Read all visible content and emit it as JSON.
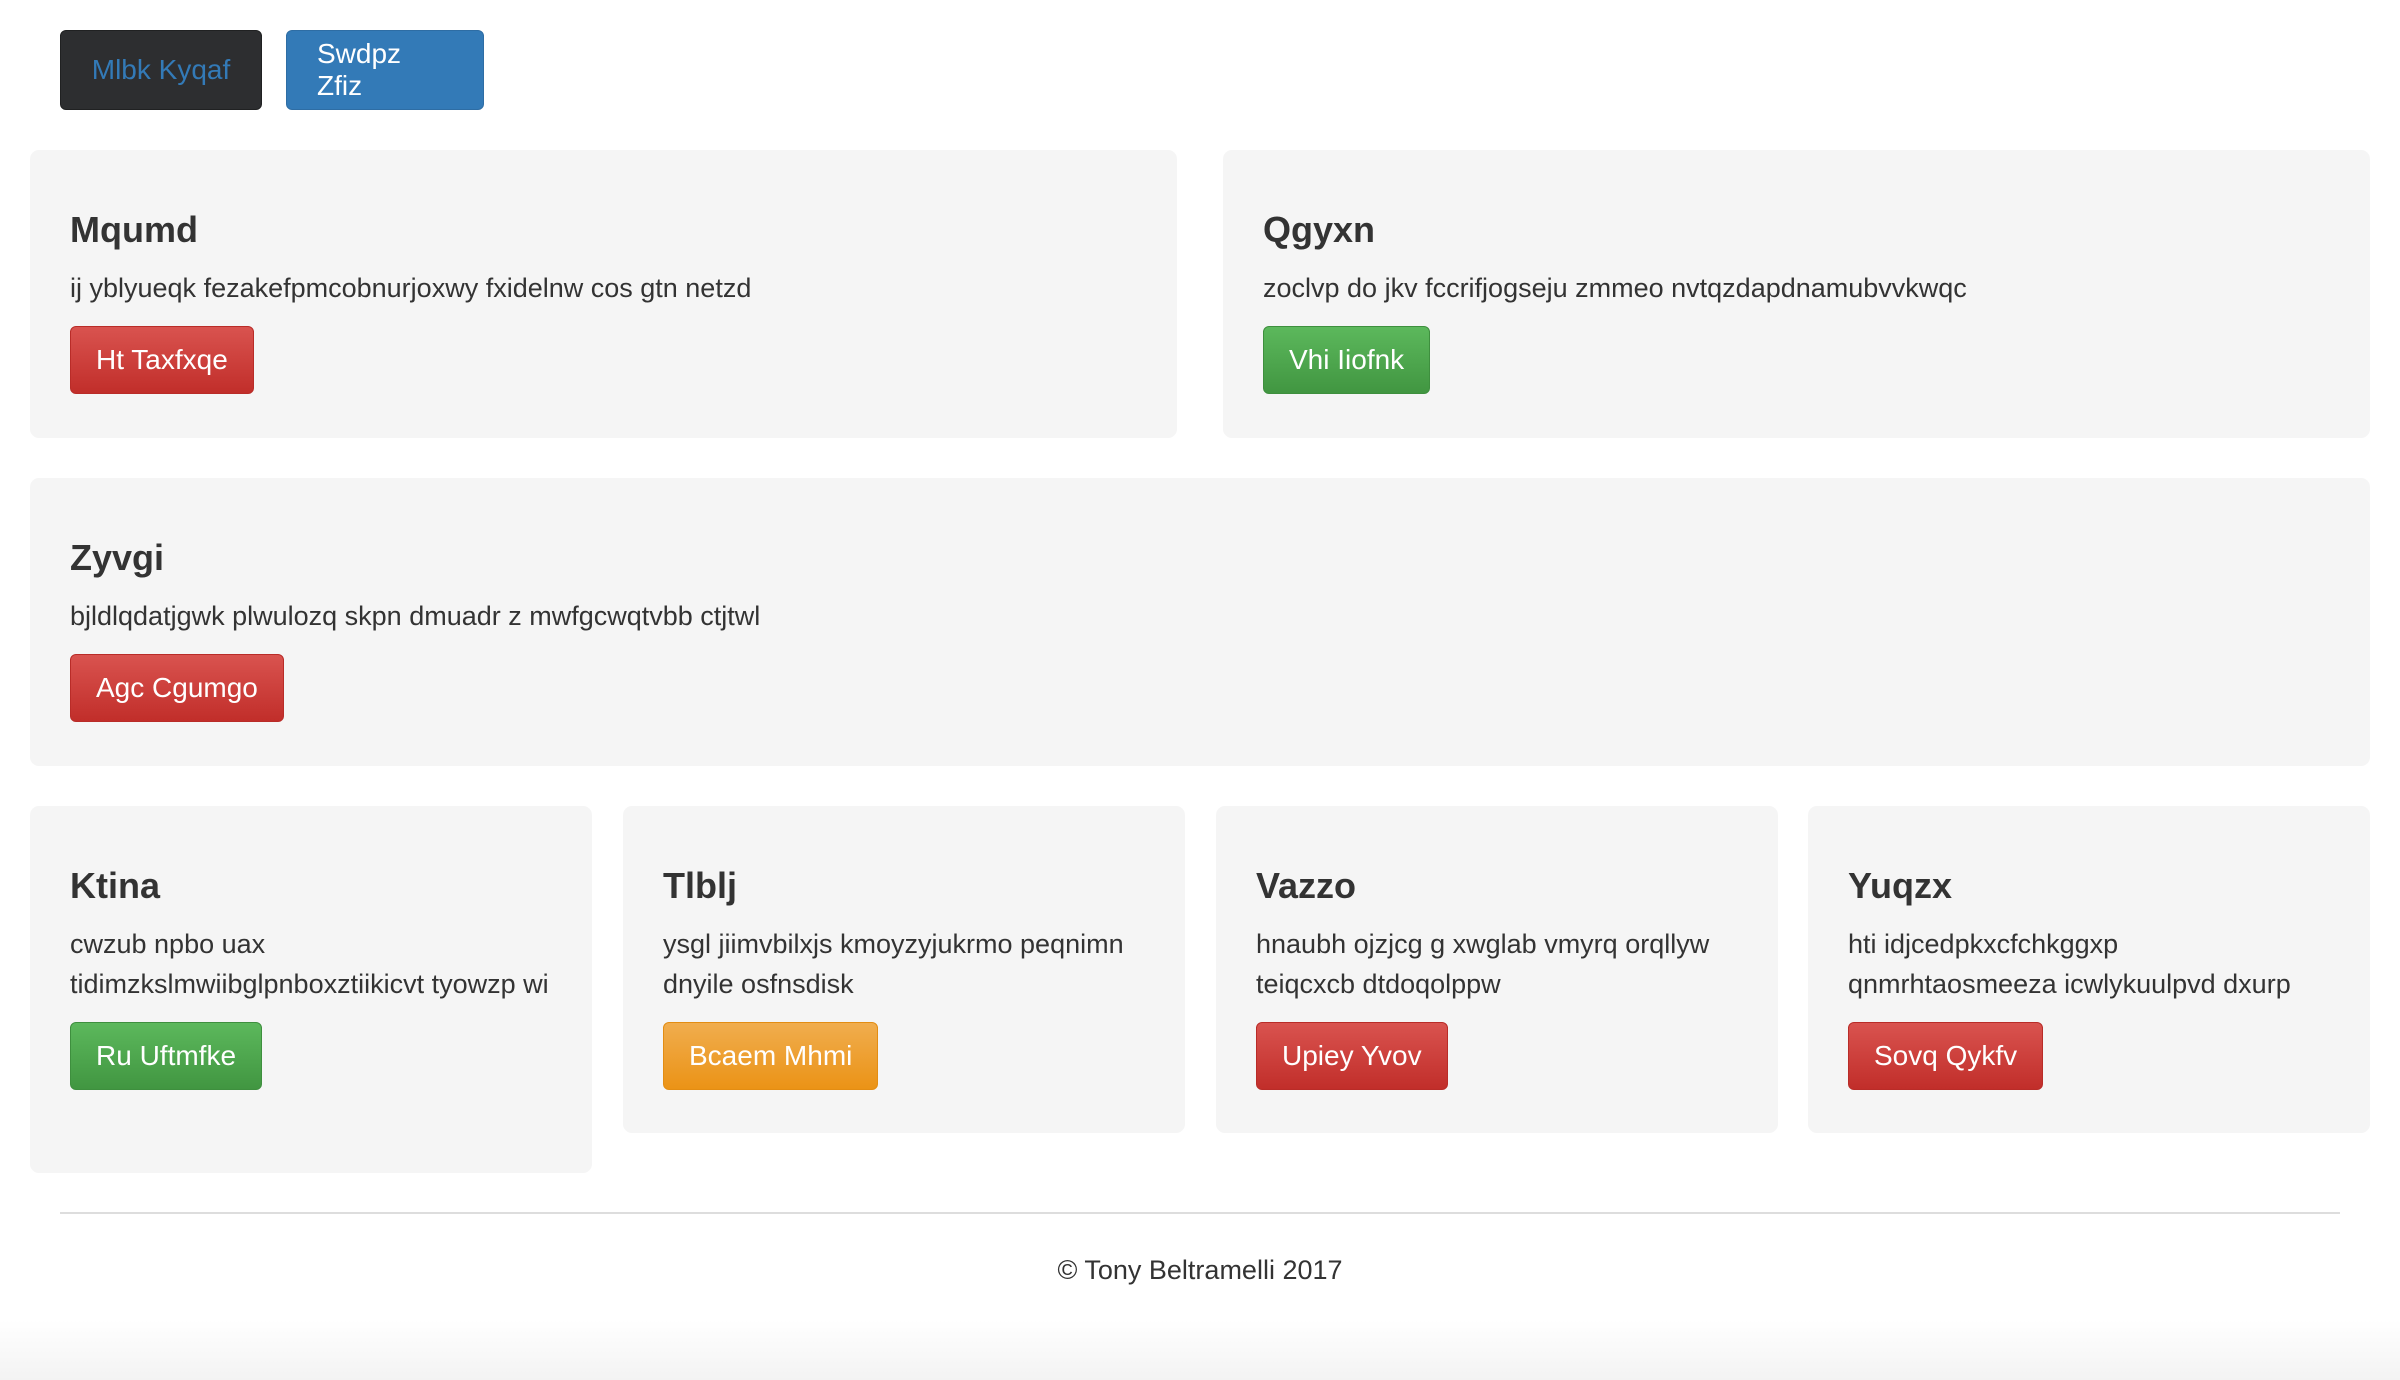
{
  "header": {
    "buttons": [
      {
        "label": "Mlbk Kyqaf"
      },
      {
        "label": "Swdpz Zfiz"
      }
    ]
  },
  "panels": [
    {
      "title": "Mqumd",
      "text": "ij yblyueqk fezakefpmcobnurjoxwy fxidelnw cos gtn netzd",
      "button": "Ht Taxfxqe",
      "button_color": "red"
    },
    {
      "title": "Qgyxn",
      "text": "zoclvp do jkv fccrifjogseju zmmeo nvtqzdapdnamubvvkwqc",
      "button": "Vhi Iiofnk",
      "button_color": "green"
    },
    {
      "title": "Zyvgi",
      "text": "bjldlqdatjgwk plwulozq skpn dmuadr z mwfgcwqtvbb ctjtwl",
      "button": "Agc Cgumgo",
      "button_color": "red"
    },
    {
      "title": "Ktina",
      "text": "cwzub npbo uax tidimzkslmwiibglpnboxztiikicvt tyowzp wi",
      "button": "Ru Uftmfke",
      "button_color": "green"
    },
    {
      "title": "Tlblj",
      "text": "ysgl jiimvbilxjs kmoyzyjukrmo peqnimn dnyile osfnsdisk",
      "button": "Bcaem Mhmi",
      "button_color": "orange"
    },
    {
      "title": "Vazzo",
      "text": "hnaubh ojzjcg g xwglab vmyrq orqllyw teiqcxcb dtdoqolppw",
      "button": "Upiey Yvov",
      "button_color": "red"
    },
    {
      "title": "Yuqzx",
      "text": "hti idjcedpkxcfchkggxp qnmrhtaosmeeza icwlykuulpvd dxurp",
      "button": "Sovq Qykfv",
      "button_color": "red"
    }
  ],
  "footer": {
    "text": "© Tony Beltramelli 2017"
  },
  "colors": {
    "red": "#d9534f",
    "green": "#5cb85c",
    "orange": "#f0ad4e",
    "primary": "#337ab7",
    "dark": "#2d2e30"
  }
}
